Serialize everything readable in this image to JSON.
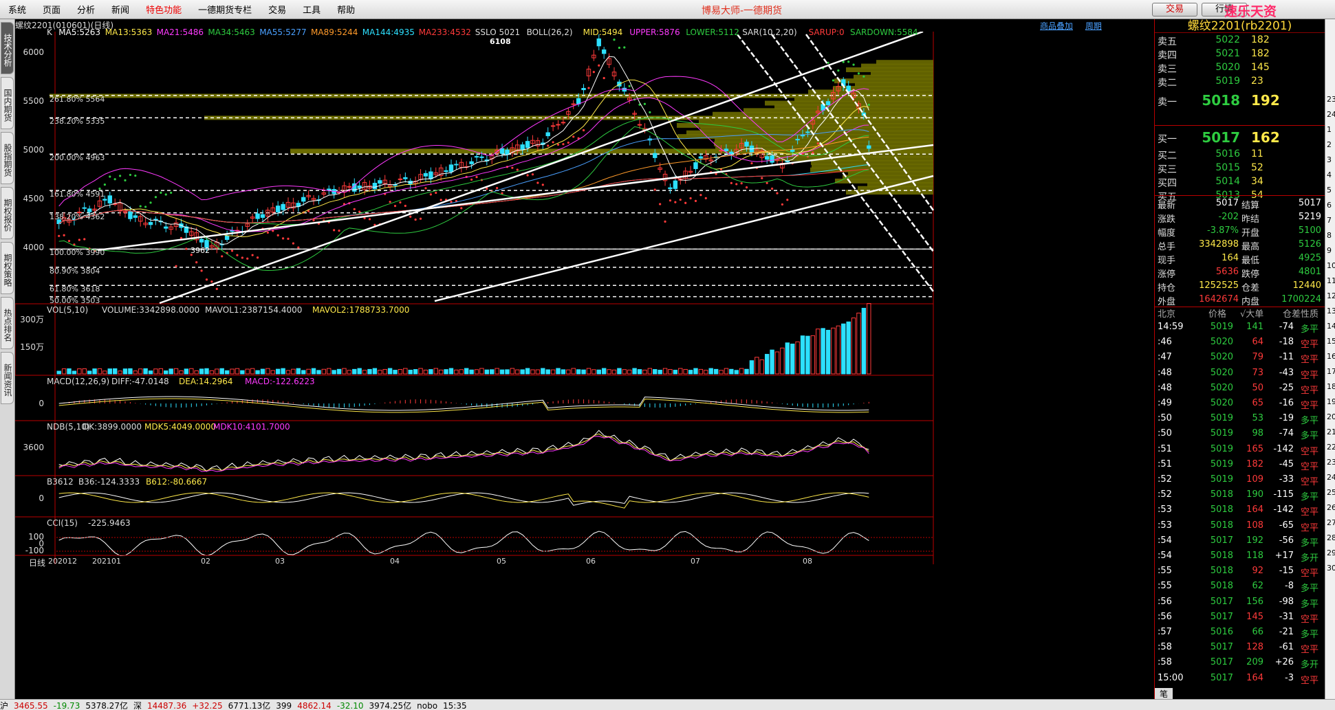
{
  "menu": {
    "items": [
      "系统",
      "页面",
      "分析",
      "新闻",
      "特色功能",
      "一德期货专栏",
      "交易",
      "工具",
      "帮助"
    ],
    "title": "博易大师-一德期货",
    "trade_btn": "交易",
    "quote_btn": "行情",
    "watermark": "速乐天资5etz.com"
  },
  "left_tabs": [
    "技术分析",
    "国内期货",
    "股指期货",
    "期权报价",
    "期权策略",
    "热点排名",
    "新闻资讯"
  ],
  "chart_header": {
    "symbol": "螺纹2201(010601)(日线)",
    "links": [
      "商品叠加",
      "周期"
    ]
  },
  "main_indicators": [
    {
      "text": "K",
      "color": "#dddddd"
    },
    {
      "text": "MA5:5263",
      "color": "#ffffff"
    },
    {
      "text": "MA13:5363",
      "color": "#ffe94a"
    },
    {
      "text": "MA21:5486",
      "color": "#ff3aff"
    },
    {
      "text": "MA34:5463",
      "color": "#2ecc40"
    },
    {
      "text": "MA55:5277",
      "color": "#4aa0ff"
    },
    {
      "text": "MA89:5244",
      "color": "#ff9a2a"
    },
    {
      "text": "MA144:4935",
      "color": "#2de0ff"
    },
    {
      "text": "MA233:4532",
      "color": "#ff3a3a"
    },
    {
      "text": "SSLO 5021",
      "color": "#dddddd"
    },
    {
      "text": "BOLL(26,2)",
      "color": "#dddddd"
    },
    {
      "text": "MID:5494",
      "color": "#ffe94a"
    },
    {
      "text": "UPPER:5876",
      "color": "#ff3aff"
    },
    {
      "text": "LOWER:5112",
      "color": "#2ecc40"
    },
    {
      "text": "SAR(10,2,20)",
      "color": "#dddddd"
    },
    {
      "text": "SARUP:0",
      "color": "#ff3a3a"
    },
    {
      "text": "SARDOWN:5584",
      "color": "#2ecc40"
    }
  ],
  "price_axis": [
    "6000",
    "5500",
    "5000",
    "4500",
    "4000"
  ],
  "fib_levels": [
    "261.80% 5564",
    "238.20% 5335",
    "200.00% 4963",
    "161.80% 4591",
    "138.20% 4362",
    "100.00% 3990",
    "80.90% 3804",
    "61.80% 3618",
    "50.00% 3503"
  ],
  "peak_label": "6108",
  "trough_label": "3962",
  "volume": {
    "title": "VOL(5,10)",
    "vol": "VOLUME:3342898.0000",
    "mavol1": "MAVOL1:2387154.4000",
    "mavol2": "MAVOL2:1788733.7000",
    "axis": [
      "300万",
      "150万"
    ]
  },
  "macd": {
    "title": "MACD(12,26,9)",
    "diff": "DIFF:-47.0148",
    "dea": "DEA:14.2964",
    "macd": "MACD:-122.6223",
    "axis": [
      "0"
    ]
  },
  "ndb": {
    "title": "NDB(5,10)",
    "dk": "DK:3899.0000",
    "mdk5": "MDK5:4049.0000",
    "mdk10": "MDK10:4101.7000",
    "axis": [
      "3600"
    ]
  },
  "b3612": {
    "title": "B3612",
    "b36": "B36:-124.3333",
    "b612": "B612:-80.6667",
    "axis": [
      "0"
    ]
  },
  "cci": {
    "title": "CCI(15)",
    "val": "-225.9463",
    "axis": [
      "100",
      "0",
      "-100"
    ]
  },
  "x_axis": {
    "label": "日线",
    "dates": [
      "202012",
      "202101",
      "02",
      "03",
      "04",
      "05",
      "06",
      "07",
      "08"
    ]
  },
  "quote": {
    "title": "螺纹2201(rb2201)",
    "asks": [
      {
        "label": "卖五",
        "price": "5022",
        "vol": "182"
      },
      {
        "label": "卖四",
        "price": "5021",
        "vol": "182"
      },
      {
        "label": "卖三",
        "price": "5020",
        "vol": "145"
      },
      {
        "label": "卖二",
        "price": "5019",
        "vol": "23"
      },
      {
        "label": "卖一",
        "price": "5018",
        "vol": "192"
      }
    ],
    "bids": [
      {
        "label": "买一",
        "price": "5017",
        "vol": "162"
      },
      {
        "label": "买二",
        "price": "5016",
        "vol": "11"
      },
      {
        "label": "买三",
        "price": "5015",
        "vol": "52"
      },
      {
        "label": "买四",
        "price": "5014",
        "vol": "34"
      },
      {
        "label": "买五",
        "price": "5013",
        "vol": "54"
      }
    ],
    "stats": [
      {
        "l1": "最新",
        "v1": "5017",
        "c1": "#ffffff",
        "l2": "结算",
        "v2": "5017",
        "c2": "#ffffff"
      },
      {
        "l1": "涨跌",
        "v1": "-202",
        "c1": "#2ecc40",
        "l2": "昨结",
        "v2": "5219",
        "c2": "#ffffff"
      },
      {
        "l1": "幅度",
        "v1": "-3.87%",
        "c1": "#2ecc40",
        "l2": "开盘",
        "v2": "5100",
        "c2": "#2ecc40"
      },
      {
        "l1": "总手",
        "v1": "3342898",
        "c1": "#ffe94a",
        "l2": "最高",
        "v2": "5126",
        "c2": "#2ecc40"
      },
      {
        "l1": "现手",
        "v1": "164",
        "c1": "#ffe94a",
        "l2": "最低",
        "v2": "4925",
        "c2": "#2ecc40"
      },
      {
        "l1": "涨停",
        "v1": "5636",
        "c1": "#ff3a3a",
        "l2": "跌停",
        "v2": "4801",
        "c2": "#2ecc40"
      },
      {
        "l1": "持仓",
        "v1": "1252525",
        "c1": "#ffe94a",
        "l2": "仓差",
        "v2": "12440",
        "c2": "#ffe94a"
      },
      {
        "l1": "外盘",
        "v1": "1642674",
        "c1": "#ff3a3a",
        "l2": "内盘",
        "v2": "1700224",
        "c2": "#2ecc40"
      }
    ],
    "tick_header": [
      "北京",
      "价格",
      "√大单",
      "仓差",
      "性质"
    ],
    "ticks": [
      {
        "t": "14:59",
        "p": "5019",
        "v": "141",
        "d": "-74",
        "n": "多平"
      },
      {
        "t": ":46",
        "p": "5020",
        "v": "64",
        "d": "-18",
        "n": "空平"
      },
      {
        "t": ":47",
        "p": "5020",
        "v": "79",
        "d": "-11",
        "n": "空平"
      },
      {
        "t": ":48",
        "p": "5020",
        "v": "73",
        "d": "-43",
        "n": "空平"
      },
      {
        "t": ":48",
        "p": "5020",
        "v": "50",
        "d": "-25",
        "n": "空平"
      },
      {
        "t": ":49",
        "p": "5020",
        "v": "65",
        "d": "-16",
        "n": "空平"
      },
      {
        "t": ":50",
        "p": "5019",
        "v": "53",
        "d": "-19",
        "n": "多平"
      },
      {
        "t": ":50",
        "p": "5019",
        "v": "98",
        "d": "-74",
        "n": "多平"
      },
      {
        "t": ":51",
        "p": "5019",
        "v": "165",
        "d": "-142",
        "n": "空平"
      },
      {
        "t": ":51",
        "p": "5019",
        "v": "182",
        "d": "-45",
        "n": "空平"
      },
      {
        "t": ":52",
        "p": "5019",
        "v": "109",
        "d": "-33",
        "n": "空平"
      },
      {
        "t": ":52",
        "p": "5018",
        "v": "190",
        "d": "-115",
        "n": "多平"
      },
      {
        "t": ":53",
        "p": "5018",
        "v": "164",
        "d": "-142",
        "n": "空平"
      },
      {
        "t": ":53",
        "p": "5018",
        "v": "108",
        "d": "-65",
        "n": "空平"
      },
      {
        "t": ":54",
        "p": "5017",
        "v": "192",
        "d": "-56",
        "n": "多平"
      },
      {
        "t": ":54",
        "p": "5018",
        "v": "118",
        "d": "+17",
        "n": "多开"
      },
      {
        "t": ":55",
        "p": "5018",
        "v": "92",
        "d": "-15",
        "n": "空平"
      },
      {
        "t": ":55",
        "p": "5018",
        "v": "62",
        "d": "-8",
        "n": "多平"
      },
      {
        "t": ":56",
        "p": "5017",
        "v": "156",
        "d": "-98",
        "n": "多平"
      },
      {
        "t": ":56",
        "p": "5017",
        "v": "145",
        "d": "-31",
        "n": "空平"
      },
      {
        "t": ":57",
        "p": "5016",
        "v": "66",
        "d": "-21",
        "n": "多平"
      },
      {
        "t": ":58",
        "p": "5017",
        "v": "128",
        "d": "-61",
        "n": "空平"
      },
      {
        "t": ":58",
        "p": "5017",
        "v": "209",
        "d": "+26",
        "n": "多开"
      },
      {
        "t": "15:00",
        "p": "5017",
        "v": "164",
        "d": "-3",
        "n": "空平"
      }
    ],
    "bottom_tab": "笔"
  },
  "right_strip": [
    "23",
    "24",
    "1",
    "2",
    "3",
    "4",
    "5",
    "6",
    "7",
    "8",
    "9",
    "10",
    "11",
    "12",
    "13",
    "14",
    "15",
    "16",
    "17",
    "18",
    "19",
    "20",
    "21",
    "22",
    "23",
    "24",
    "25",
    "26",
    "27",
    "28",
    "29",
    "30"
  ],
  "status": [
    "沪",
    "3465.55",
    "-19.73",
    "5378.27亿",
    "深",
    "14487.36",
    "+32.25",
    "6771.13亿",
    "399",
    "4862.14",
    "-32.10",
    "3974.25亿",
    "nobo",
    "15:35"
  ]
}
